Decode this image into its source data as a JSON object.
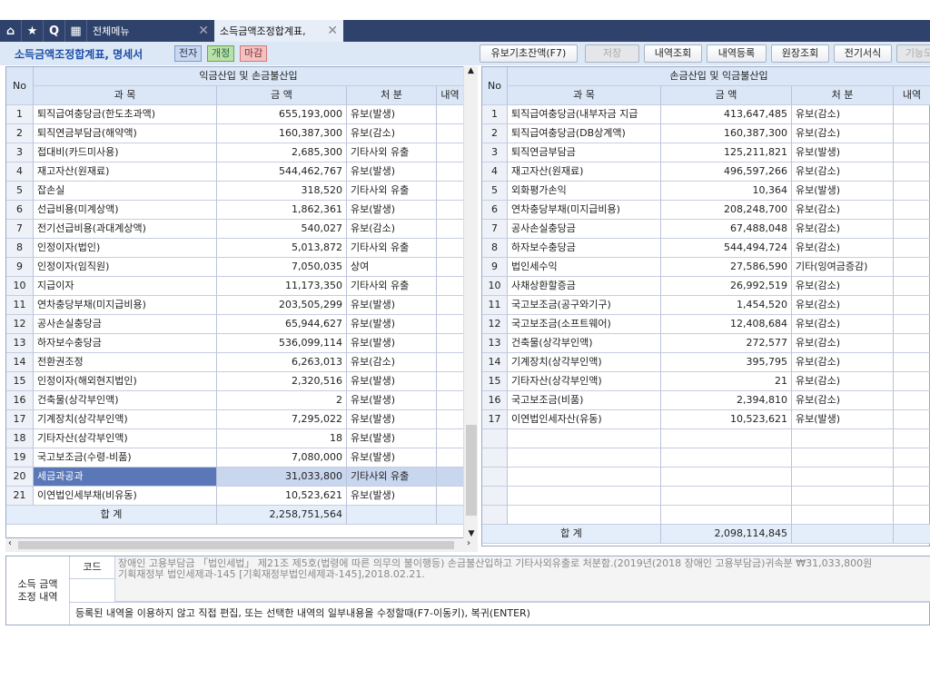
{
  "tabs": {
    "menu": "전체메뉴",
    "active": "소득금액조정합계표,"
  },
  "toolbar": {
    "title": "소득금액조정합계표, 명세서",
    "badge_e": "전자",
    "badge_rev": "개정",
    "badge_close": "마감",
    "buttons": [
      "유보기초잔액(F7)",
      "저장",
      "내역조회",
      "내역등록",
      "원장조회",
      "전기서식",
      "기능모"
    ]
  },
  "left": {
    "group": "익금산입 및 손금불산입",
    "headers": {
      "no": "No",
      "item": "과  목",
      "amount": "금  액",
      "disp": "처  분",
      "detail": "내역"
    },
    "rows": [
      [
        "1",
        "퇴직급여충당금(한도초과액)",
        "655,193,000",
        "유보(발생)"
      ],
      [
        "2",
        "퇴직연금부담금(해약액)",
        "160,387,300",
        "유보(감소)"
      ],
      [
        "3",
        "접대비(카드미사용)",
        "2,685,300",
        "기타사외 유출"
      ],
      [
        "4",
        "재고자산(원재료)",
        "544,462,767",
        "유보(발생)"
      ],
      [
        "5",
        "잡손실",
        "318,520",
        "기타사외 유출"
      ],
      [
        "6",
        "선급비용(미계상액)",
        "1,862,361",
        "유보(발생)"
      ],
      [
        "7",
        "전기선급비용(과대계상액)",
        "540,027",
        "유보(감소)"
      ],
      [
        "8",
        "인정이자(법인)",
        "5,013,872",
        "기타사외 유출"
      ],
      [
        "9",
        "인정이자(임직원)",
        "7,050,035",
        "상여"
      ],
      [
        "10",
        "지급이자",
        "11,173,350",
        "기타사외 유출"
      ],
      [
        "11",
        "연차충당부채(미지급비용)",
        "203,505,299",
        "유보(발생)"
      ],
      [
        "12",
        "공사손실충당금",
        "65,944,627",
        "유보(발생)"
      ],
      [
        "13",
        "하자보수충당금",
        "536,099,114",
        "유보(발생)"
      ],
      [
        "14",
        "전환권조정",
        "6,263,013",
        "유보(감소)"
      ],
      [
        "15",
        "인정이자(해외현지법인)",
        "2,320,516",
        "유보(발생)"
      ],
      [
        "16",
        "건축물(상각부인액)",
        "2",
        "유보(발생)"
      ],
      [
        "17",
        "기계장치(상각부인액)",
        "7,295,022",
        "유보(발생)"
      ],
      [
        "18",
        "기타자산(상각부인액)",
        "18",
        "유보(발생)"
      ],
      [
        "19",
        "국고보조금(수령-비품)",
        "7,080,000",
        "유보(발생)"
      ],
      [
        "20",
        "세금과공과",
        "31,033,800",
        "기타사외 유출"
      ],
      [
        "21",
        "이연법인세부채(비유동)",
        "10,523,621",
        "유보(발생)"
      ]
    ],
    "total_label": "합 계",
    "total": "2,258,751,564"
  },
  "right": {
    "group": "손금산입 및 익금불산입",
    "headers": {
      "no": "No",
      "item": "과  목",
      "amount": "금  액",
      "disp": "처  분",
      "detail": "내역"
    },
    "rows": [
      [
        "1",
        "퇴직급여충당금(내부자금 지급",
        "413,647,485",
        "유보(감소)"
      ],
      [
        "2",
        "퇴직급여충당금(DB상계액)",
        "160,387,300",
        "유보(감소)"
      ],
      [
        "3",
        "퇴직연금부담금",
        "125,211,821",
        "유보(발생)"
      ],
      [
        "4",
        "재고자산(원재료)",
        "496,597,266",
        "유보(감소)"
      ],
      [
        "5",
        "외화평가손익",
        "10,364",
        "유보(발생)"
      ],
      [
        "6",
        "연차충당부채(미지급비용)",
        "208,248,700",
        "유보(감소)"
      ],
      [
        "7",
        "공사손실충당금",
        "67,488,048",
        "유보(감소)"
      ],
      [
        "8",
        "하자보수충당금",
        "544,494,724",
        "유보(감소)"
      ],
      [
        "9",
        "법인세수익",
        "27,586,590",
        "기타(잉여금증감)"
      ],
      [
        "10",
        "사채상환할증금",
        "26,992,519",
        "유보(감소)"
      ],
      [
        "11",
        "국고보조금(공구와기구)",
        "1,454,520",
        "유보(감소)"
      ],
      [
        "12",
        "국고보조금(소프트웨어)",
        "12,408,684",
        "유보(감소)"
      ],
      [
        "13",
        "건축물(상각부인액)",
        "272,577",
        "유보(감소)"
      ],
      [
        "14",
        "기계장치(상각부인액)",
        "395,795",
        "유보(감소)"
      ],
      [
        "15",
        "기타자산(상각부인액)",
        "21",
        "유보(감소)"
      ],
      [
        "16",
        "국고보조금(비품)",
        "2,394,810",
        "유보(감소)"
      ],
      [
        "17",
        "이연법인세자산(유동)",
        "10,523,621",
        "유보(발생)"
      ]
    ],
    "total_label": "합 계",
    "total": "2,098,114,845"
  },
  "bottom": {
    "label1": "소득 금액",
    "label2": "조정 내역",
    "code_label": "코드",
    "text1": "장애인 고용부담금 「법인세법」 제21조 제5호(법령에 따른 의무의 불이행등) 손금불산입하고 기타사외유출로 처분함.(2019년(2018 장애인 고용부담금)귀속분 ₩31,033,800원",
    "text2": "기획재정부 법인세제과-145 [기획재정부법인세제과-145],2018.02.21.",
    "hint": "등록된 내역을 이용하지 않고 직접 편집, 또는 선택한 내역의 일부내용을 수정할때(F7-이동키), 복귀(ENTER)"
  },
  "selected_left_row": 20
}
